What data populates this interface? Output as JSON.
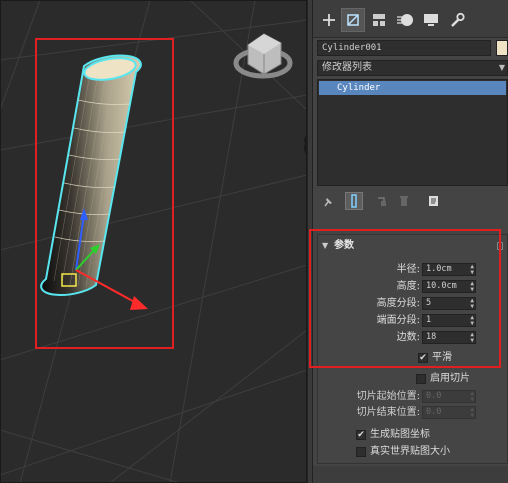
{
  "app": {
    "accent": "#5a86be",
    "annotation_color": "#e02020"
  },
  "command_panel": {
    "tabs": [
      {
        "name": "create-icon"
      },
      {
        "name": "modify-icon",
        "active": true
      },
      {
        "name": "hierarchy-icon"
      },
      {
        "name": "motion-icon"
      },
      {
        "name": "display-icon"
      },
      {
        "name": "utilities-icon"
      }
    ],
    "object_name": "Cylinder001",
    "object_color": "#f0e2c4",
    "modifier_list_label": "修改器列表",
    "stack_items": [
      "Cylinder"
    ],
    "stack_tools": [
      "pin-stack-icon",
      "show-end-result-icon",
      "make-unique-icon",
      "remove-modifier-icon",
      "configure-sets-icon"
    ]
  },
  "parameters": {
    "title": "参数",
    "radius": {
      "label": "半径:",
      "value": "1.0cm"
    },
    "height": {
      "label": "高度:",
      "value": "10.0cm"
    },
    "height_segments": {
      "label": "高度分段:",
      "value": "5"
    },
    "cap_segments": {
      "label": "端面分段:",
      "value": "1"
    },
    "sides": {
      "label": "边数:",
      "value": "18"
    },
    "smooth": {
      "label": "平滑",
      "checked": true
    },
    "slice_on": {
      "label": "启用切片",
      "checked": false
    },
    "slice_from": {
      "label": "切片起始位置:",
      "value": "0.0"
    },
    "slice_to": {
      "label": "切片结束位置:",
      "value": "0.0"
    },
    "gen_mapping": {
      "label": "生成贴图坐标",
      "checked": true
    },
    "real_world": {
      "label": "真实世界贴图大小",
      "checked": false
    }
  }
}
